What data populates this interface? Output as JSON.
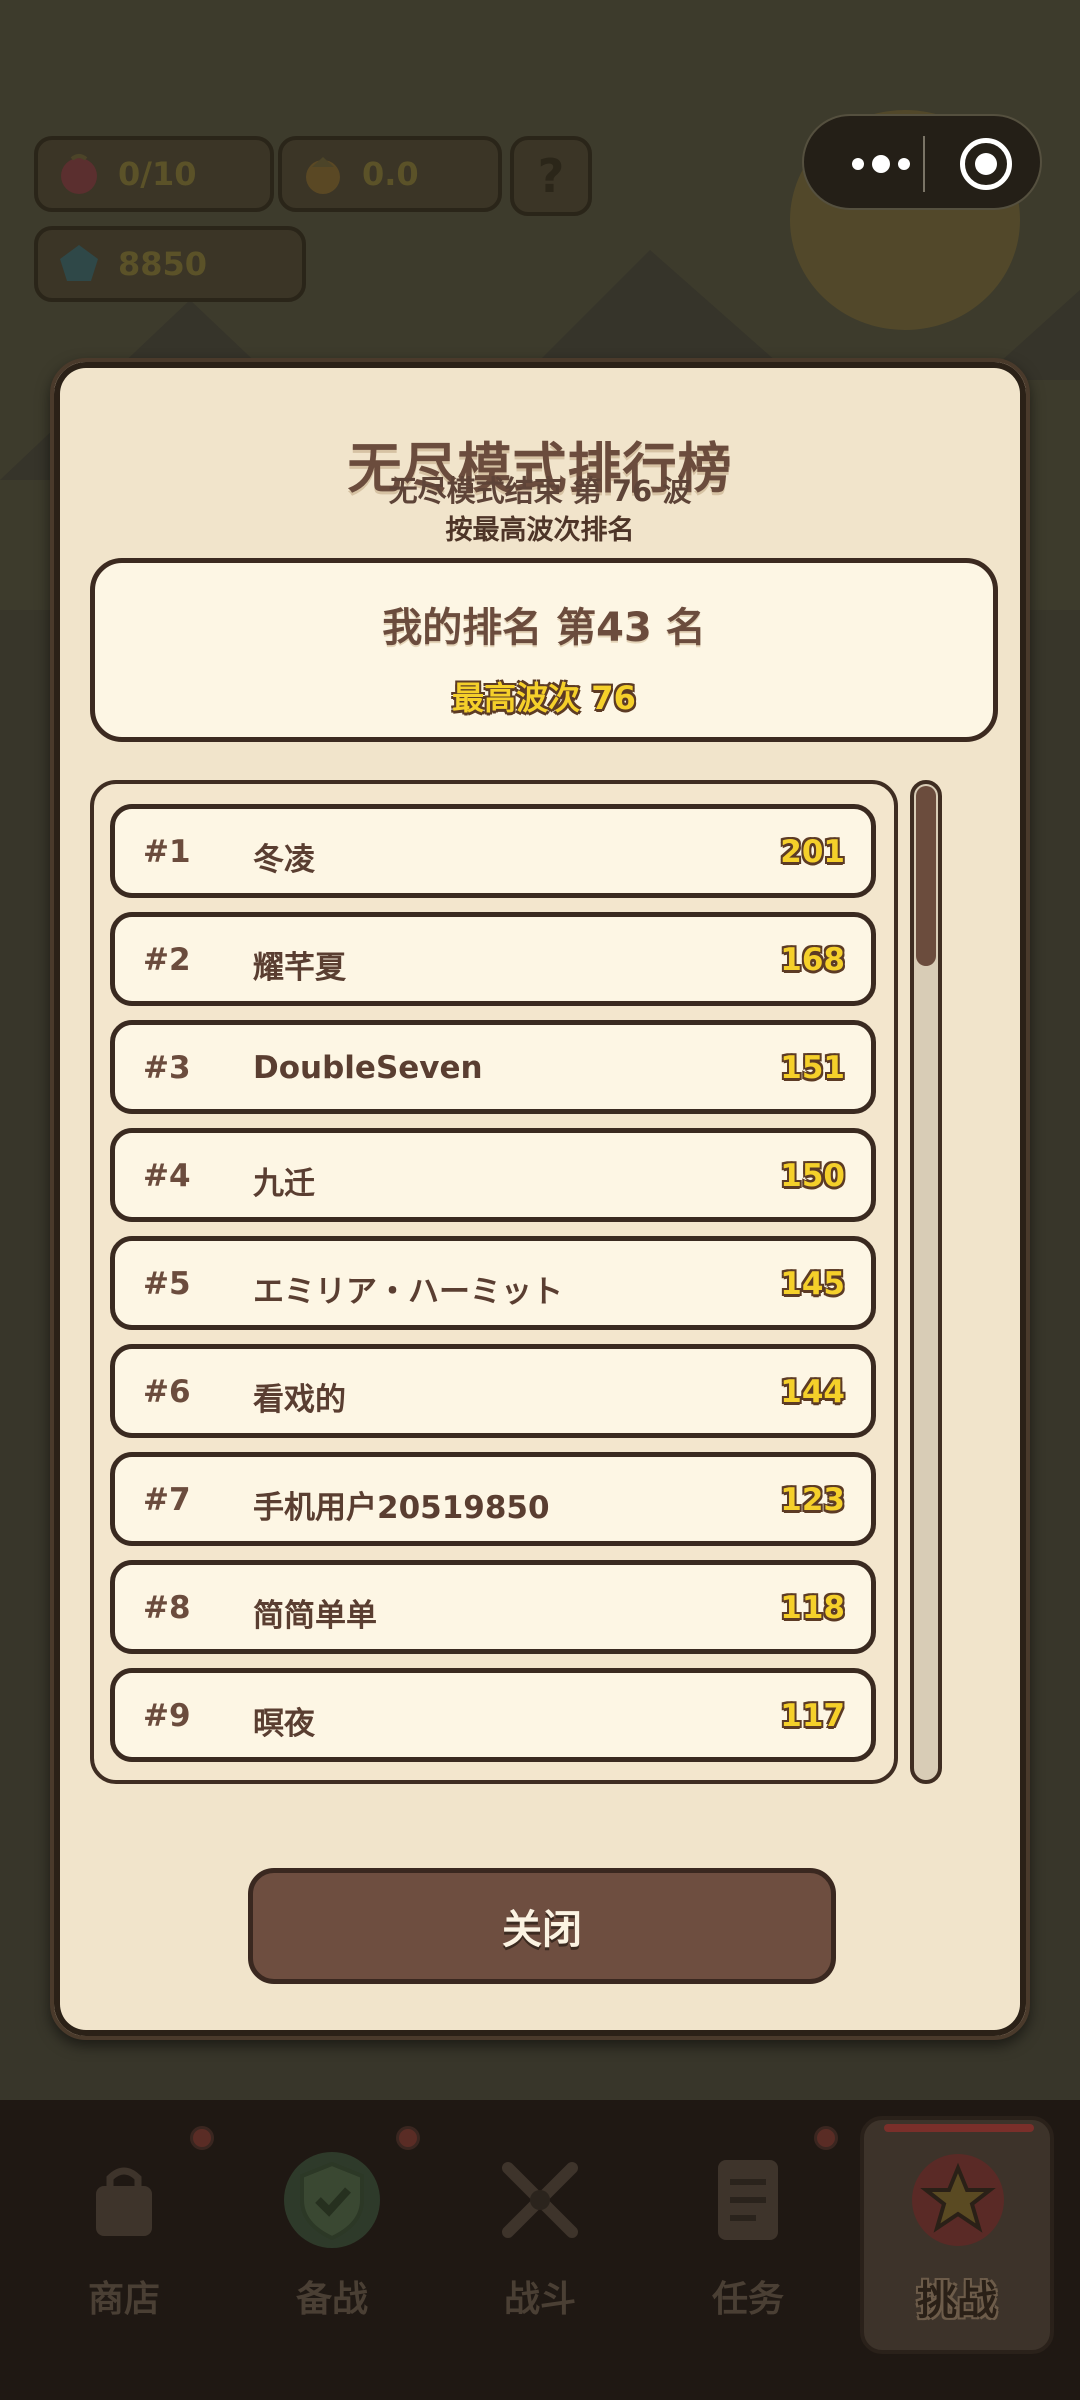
{
  "hud": {
    "hearts": "0/10",
    "energy": "0.0",
    "gems": "8850",
    "help_label": "?"
  },
  "modal": {
    "title": "无尽模式排行榜",
    "subtitle": "无尽模式结束 第 76 波",
    "sort_note": "按最高波次排名",
    "my_rank": "我的排名 第43 名",
    "my_best": "最高波次 76",
    "close_label": "关闭"
  },
  "leaderboard": [
    {
      "rank": "#1",
      "name": "冬凌",
      "score": "201"
    },
    {
      "rank": "#2",
      "name": "耀芊夏",
      "score": "168"
    },
    {
      "rank": "#3",
      "name": "DoubleSeven",
      "score": "151"
    },
    {
      "rank": "#4",
      "name": "九迁",
      "score": "150"
    },
    {
      "rank": "#5",
      "name": "エミリア・ハーミット",
      "score": "145"
    },
    {
      "rank": "#6",
      "name": "看戏的",
      "score": "144"
    },
    {
      "rank": "#7",
      "name": "手机用户20519850",
      "score": "123"
    },
    {
      "rank": "#8",
      "name": "简简单单",
      "score": "118"
    },
    {
      "rank": "#9",
      "name": "暝夜",
      "score": "117"
    }
  ],
  "nav": {
    "shop": "商店",
    "prepare": "备战",
    "battle": "战斗",
    "tasks": "任务",
    "challenge": "挑战"
  },
  "colors": {
    "modal_bg": "#f1e4cb",
    "border_brown": "#3c2a20",
    "score_yellow": "#f5d02a",
    "button_brown": "#6e4e40"
  },
  "icons": {
    "hearts": "heart-icon",
    "energy": "acorn-icon",
    "gems": "gem-icon",
    "more": "more-dots-icon",
    "exit": "target-close-icon",
    "shop": "bag-icon",
    "prepare": "shield-check-icon",
    "battle": "crossed-swords-icon",
    "tasks": "clipboard-icon",
    "challenge": "star-icon"
  }
}
